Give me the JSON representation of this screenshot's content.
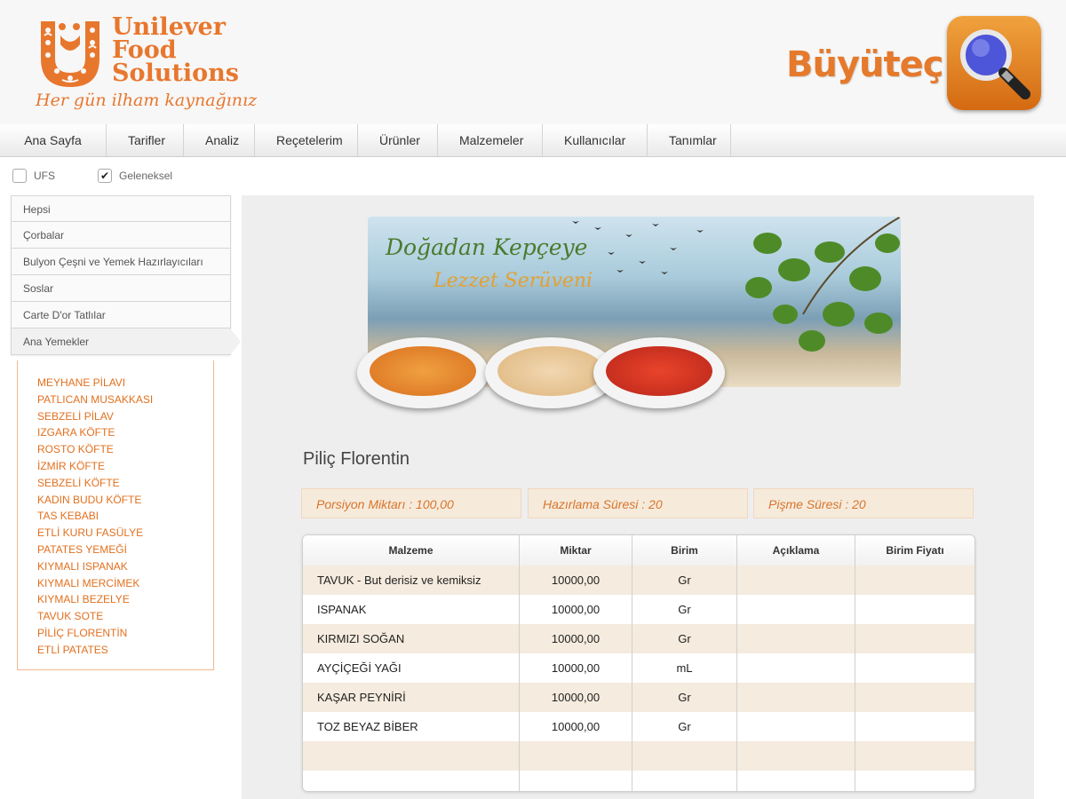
{
  "header": {
    "brand_lines": [
      "Unilever",
      "Food",
      "Solutions"
    ],
    "tagline": "Her gün ilham kaynağınız",
    "app_title": "Büyüteç",
    "app_icon": "magnifier-icon"
  },
  "nav": {
    "items": [
      "Ana Sayfa",
      "Tarifler",
      "Analiz",
      "Reçetelerim",
      "Ürünler",
      "Malzemeler",
      "Kullanıcılar",
      "Tanımlar"
    ]
  },
  "filters": {
    "ufs": {
      "label": "UFS",
      "checked": false
    },
    "traditional": {
      "label": "Geleneksel",
      "checked": true
    }
  },
  "categories": [
    "Hepsi",
    "Çorbalar",
    "Bulyon Çeşni ve Yemek Hazırlayıcıları",
    "Soslar",
    "Carte D'or Tatlılar",
    "Ana Yemekler"
  ],
  "active_category": "Ana Yemekler",
  "recipes": [
    "MEYHANE PİLAVI",
    "PATLICAN MUSAKKASI",
    "SEBZELİ PİLAV",
    "IZGARA KÖFTE",
    "ROSTO KÖFTE",
    "İZMİR KÖFTE",
    "SEBZELİ KÖFTE",
    "KADIN BUDU KÖFTE",
    "TAS KEBABI",
    "ETLİ KURU FASÜLYE",
    "PATATES YEMEĞİ",
    "KIYMALI ISPANAK",
    "KIYMALI MERCİMEK",
    "KIYMALI BEZELYE",
    "TAVUK SOTE",
    "PİLİÇ FLORENTİN",
    "ETLİ PATATES"
  ],
  "banner": {
    "line1": "Doğadan Kepçeye",
    "line2": "Lezzet Serüveni"
  },
  "recipe": {
    "title": "Piliç Florentin",
    "portion": "Porsiyon Miktarı : 100,00",
    "prep_time": "Hazırlama Süresi : 20",
    "cook_time": "Pişme Süresi : 20"
  },
  "table": {
    "headers": [
      "Malzeme",
      "Miktar",
      "Birim",
      "Açıklama",
      "Birim Fiyatı"
    ],
    "rows": [
      [
        "TAVUK - But derisiz ve kemiksiz",
        "10000,00",
        "Gr",
        "",
        ""
      ],
      [
        "ISPANAK",
        "10000,00",
        "Gr",
        "",
        ""
      ],
      [
        "KIRMIZI SOĞAN",
        "10000,00",
        "Gr",
        "",
        ""
      ],
      [
        "AYÇİÇEĞİ YAĞI",
        "10000,00",
        "mL",
        "",
        ""
      ],
      [
        "KAŞAR PEYNİRİ",
        "10000,00",
        "Gr",
        "",
        ""
      ],
      [
        "TOZ BEYAZ BİBER",
        "10000,00",
        "Gr",
        "",
        ""
      ],
      [
        "",
        "",
        "",
        "",
        ""
      ],
      [
        "",
        "",
        "",
        "",
        ""
      ]
    ]
  },
  "colors": {
    "brand_orange": "#e8772e",
    "recipe_link": "#e2701f",
    "info_bg": "#f6eadb",
    "row_alt_bg": "#f5ebde"
  }
}
